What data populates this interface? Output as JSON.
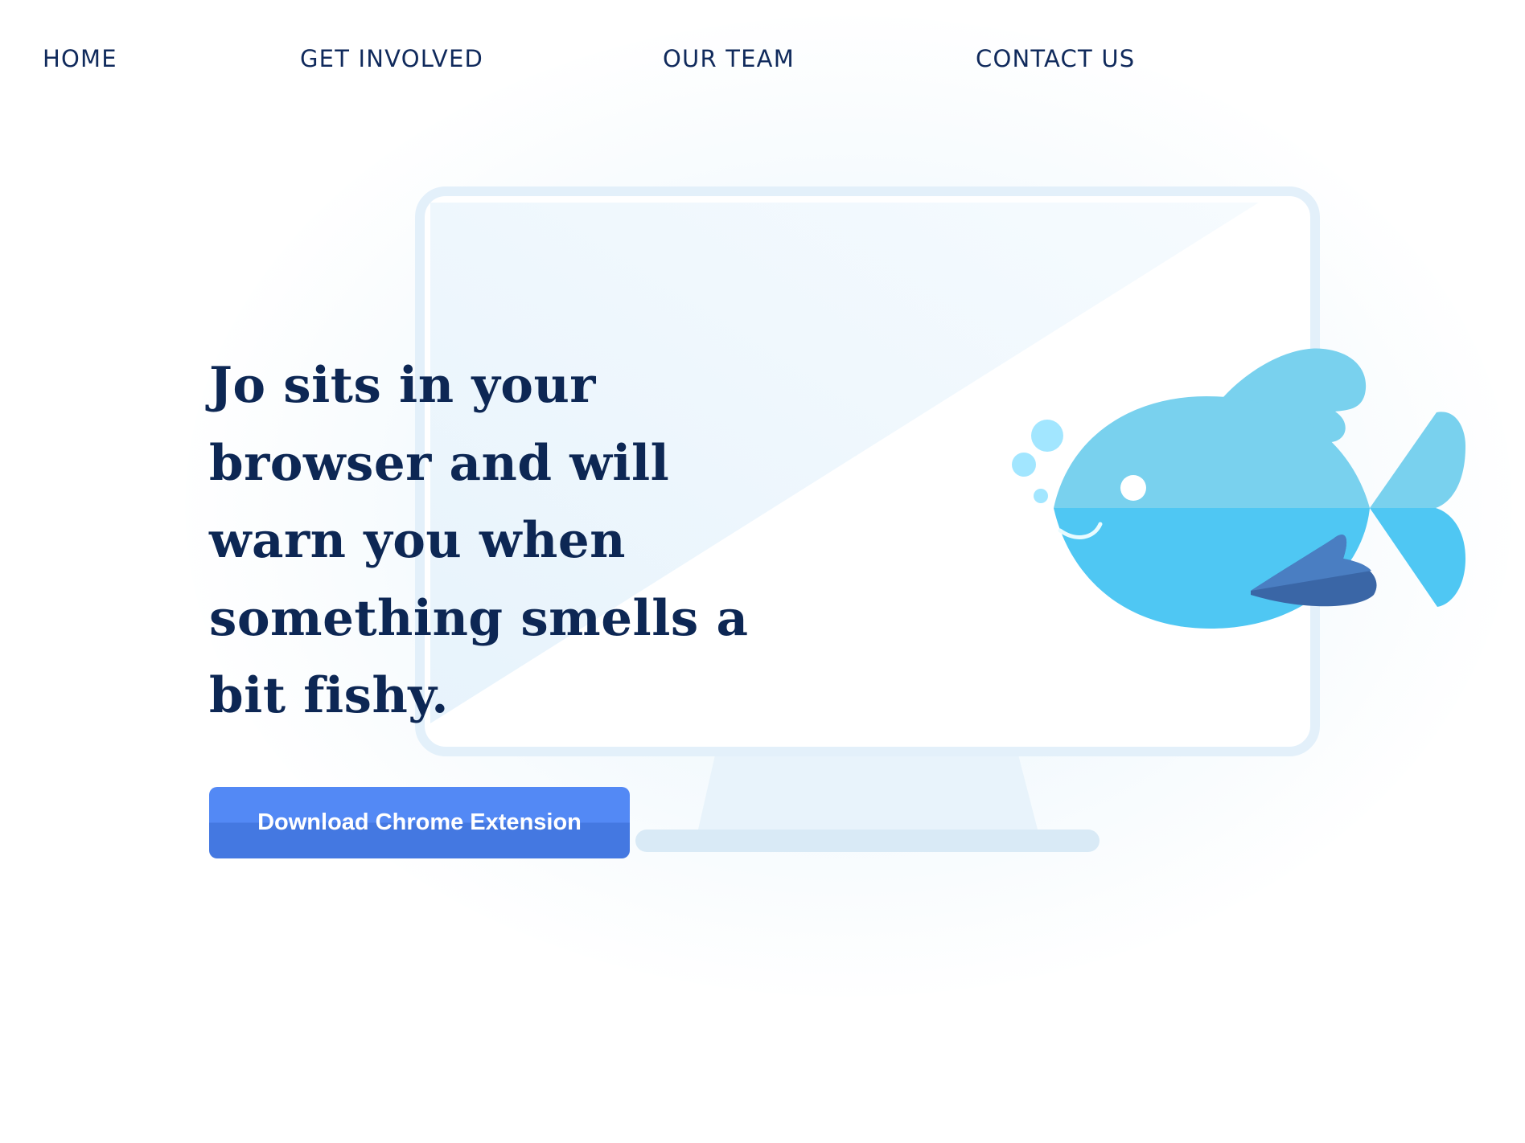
{
  "nav": {
    "items": [
      {
        "label": "HOME"
      },
      {
        "label": "GET INVOLVED"
      },
      {
        "label": "OUR TEAM"
      },
      {
        "label": "CONTACT US"
      }
    ]
  },
  "hero": {
    "heading": "Jo sits in your browser and will warn you when something smells a bit fishy.",
    "cta_label": "Download Chrome Extension"
  },
  "colors": {
    "text_navy": "#0d2754",
    "button_blue": "#5389f5",
    "fish_light": "#79d1ee",
    "fish_main": "#4fc7f3",
    "fin_dark": "#3a66a6"
  }
}
